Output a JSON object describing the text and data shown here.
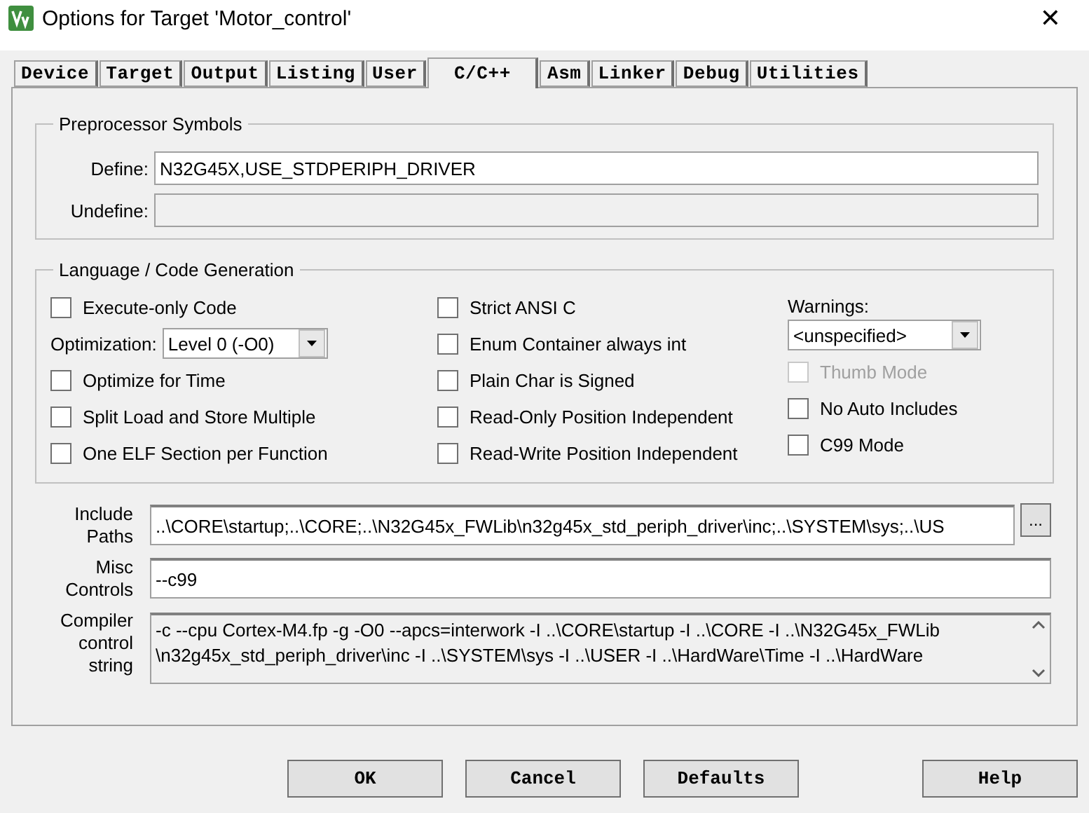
{
  "window": {
    "title": "Options for Target 'Motor_control'",
    "close": "✕"
  },
  "tabs": [
    {
      "label": "Device",
      "selected": false
    },
    {
      "label": "Target",
      "selected": false
    },
    {
      "label": "Output",
      "selected": false
    },
    {
      "label": "Listing",
      "selected": false
    },
    {
      "label": "User",
      "selected": false
    },
    {
      "label": "C/C++",
      "selected": true
    },
    {
      "label": "Asm",
      "selected": false
    },
    {
      "label": "Linker",
      "selected": false
    },
    {
      "label": "Debug",
      "selected": false
    },
    {
      "label": "Utilities",
      "selected": false
    }
  ],
  "preprocessor": {
    "title": "Preprocessor Symbols",
    "fields": [
      {
        "label": "Define:",
        "value": "N32G45X,USE_STDPERIPH_DRIVER",
        "disabled": false
      },
      {
        "label": "Undefine:",
        "disabled": true
      }
    ]
  },
  "language": {
    "title": "Language / Code Generation",
    "columns": [
      [
        {
          "kind": "checkbox",
          "label": "Execute-only Code",
          "checked": false,
          "disabled": false
        },
        {
          "kind": "select",
          "label": "Optimization:",
          "value": "Level 0 (-O0)"
        },
        {
          "kind": "checkbox",
          "label": "Optimize for Time",
          "checked": false,
          "disabled": false
        },
        {
          "kind": "checkbox",
          "label": "Split Load and Store Multiple",
          "checked": false,
          "disabled": false
        },
        {
          "kind": "checkbox",
          "label": "One ELF Section per Function",
          "checked": false,
          "disabled": false
        }
      ],
      [
        {
          "kind": "checkbox",
          "label": "Strict ANSI C",
          "checked": false,
          "disabled": false
        },
        {
          "kind": "checkbox",
          "label": "Enum Container always int",
          "checked": false,
          "disabled": false
        },
        {
          "kind": "checkbox",
          "label": "Plain Char is Signed",
          "checked": false,
          "disabled": false
        },
        {
          "kind": "checkbox",
          "label": "Read-Only Position Independent",
          "checked": false,
          "disabled": false
        },
        {
          "kind": "checkbox",
          "label": "Read-Write Position Independent",
          "checked": false,
          "disabled": false
        }
      ],
      [
        {
          "kind": "labeled-select",
          "label": "Warnings:",
          "value": "<unspecified>"
        },
        {
          "kind": "checkbox",
          "label": "Thumb Mode",
          "checked": false,
          "disabled": true
        },
        {
          "kind": "checkbox",
          "label": "No Auto Includes",
          "checked": false,
          "disabled": false
        },
        {
          "kind": "checkbox",
          "label": "C99 Mode",
          "checked": false,
          "disabled": false
        }
      ]
    ]
  },
  "include_paths": {
    "label": [
      "Include",
      "Paths"
    ],
    "value": "..\\CORE\\startup;..\\CORE;..\\N32G45x_FWLib\\n32g45x_std_periph_driver\\inc;..\\SYSTEM\\sys;..\\US",
    "browse": "..."
  },
  "misc_controls": {
    "label": [
      "Misc",
      "Controls"
    ],
    "value": "--c99"
  },
  "compiler_control_string": {
    "label": [
      "Compiler",
      "control",
      "string"
    ],
    "lines": [
      "-c --cpu Cortex-M4.fp -g -O0 --apcs=interwork -I ..\\CORE\\startup -I ..\\CORE -I ..\\N32G45x_FWLib",
      "\\n32g45x_std_periph_driver\\inc -I ..\\SYSTEM\\sys -I ..\\USER -I ..\\HardWare\\Time -I ..\\HardWare"
    ]
  },
  "buttons": [
    {
      "label": "OK",
      "kind": "action"
    },
    {
      "label": "Cancel",
      "kind": "action"
    },
    {
      "label": "Defaults",
      "kind": "action"
    },
    {
      "label": "Help",
      "kind": "help"
    }
  ]
}
